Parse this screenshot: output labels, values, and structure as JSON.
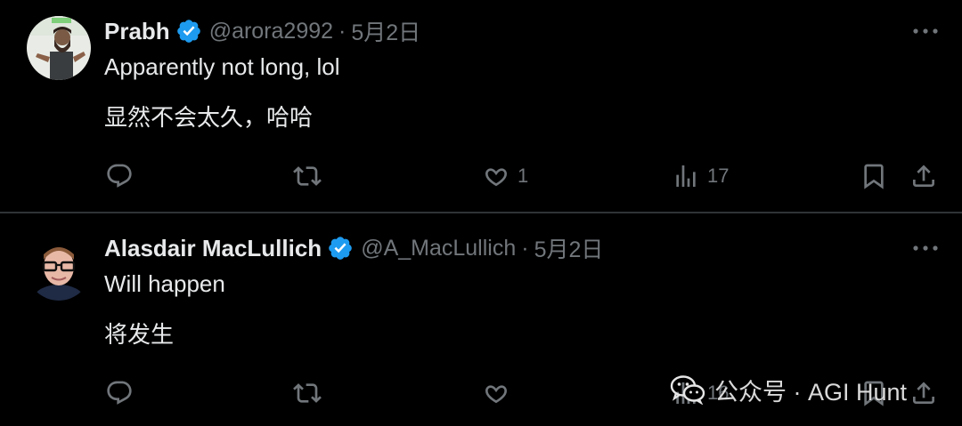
{
  "tweets": [
    {
      "name": "Prabh",
      "handle": "@arora2992",
      "separator": "·",
      "date": "5月2日",
      "text": "Apparently not long, lol",
      "translation": "显然不会太久，哈哈",
      "actions": {
        "reply_count": "",
        "retweet_count": "",
        "like_count": "1",
        "views_count": "17"
      }
    },
    {
      "name": "Alasdair MacLullich",
      "handle": "@A_MacLullich",
      "separator": "·",
      "date": "5月2日",
      "text": "Will happen",
      "translation": "将发生",
      "actions": {
        "reply_count": "",
        "retweet_count": "",
        "like_count": "",
        "views_count": "16"
      }
    }
  ],
  "watermark": {
    "text": "公众号 · AGI Hunt",
    "icon": "wechat-icon"
  },
  "colors": {
    "background": "#000000",
    "text": "#e7e9ea",
    "muted": "#71767b",
    "verified": "#1d9bf0",
    "divider": "#2f3336"
  }
}
